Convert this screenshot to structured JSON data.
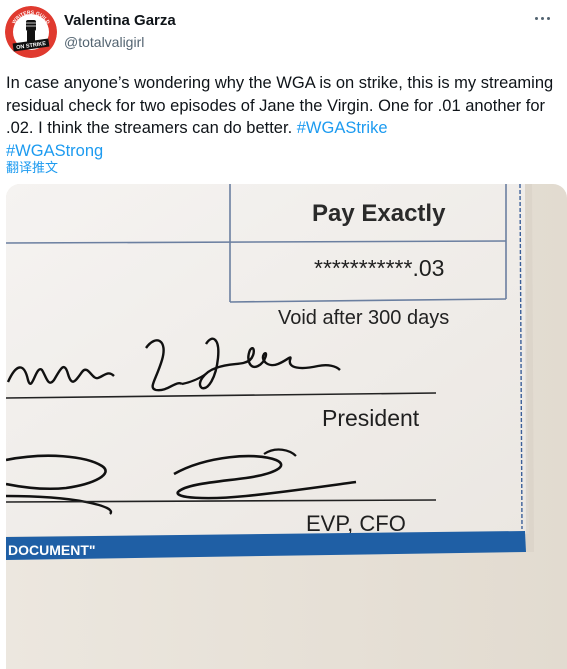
{
  "author": {
    "display_name": "Valentina Garza",
    "handle": "@totalvaligirl",
    "avatar_text_top": "WRITERS GUILD",
    "avatar_text_bottom": "ON STRIKE"
  },
  "tweet": {
    "text_plain": "In case anyone’s wondering why the WGA is on strike, this is my streaming residual check for two episodes of Jane the Virgin. One for .01 another for .02. I think the streamers can do better. ",
    "hashtag_1": "#WGAStrike",
    "hashtag_2": "#WGAStrong",
    "translate_label": "翻译推文"
  },
  "media": {
    "pay_exactly_label": "Pay Exactly",
    "amount": "***********.03",
    "void_notice": "Void after 300 days",
    "president_label": "President",
    "evp_label": "EVP, CFO",
    "footer_text": "DOCUMENT\"",
    "colors": {
      "paper": "#f3f1ee",
      "ink": "#1a1a1a",
      "stripe": "#1f5fa5",
      "grid_line": "#6b7fa0"
    }
  },
  "icons": {
    "more": "more-horizontal-icon"
  }
}
